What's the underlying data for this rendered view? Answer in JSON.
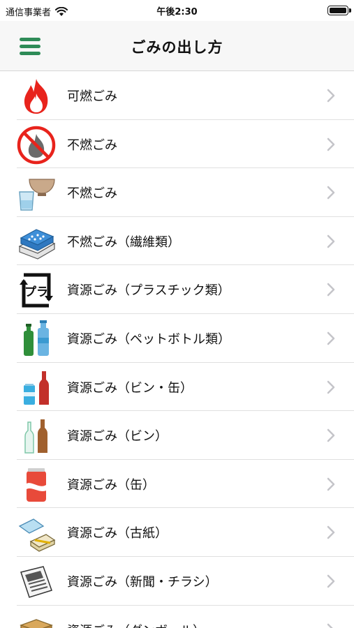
{
  "status_bar": {
    "carrier": "通信事業者",
    "time": "午後2:30"
  },
  "nav": {
    "title": "ごみの出し方"
  },
  "items": [
    {
      "label": "可燃ごみ",
      "icon": "burnable-fire-icon"
    },
    {
      "label": "不燃ごみ",
      "icon": "no-fire-icon"
    },
    {
      "label": "不燃ごみ",
      "icon": "bowl-glass-icon"
    },
    {
      "label": "不燃ごみ（繊維類）",
      "icon": "fabric-icon"
    },
    {
      "label": "資源ごみ（プラスチック類）",
      "icon": "plastic-recycle-icon"
    },
    {
      "label": "資源ごみ（ペットボトル類）",
      "icon": "pet-bottles-icon"
    },
    {
      "label": "資源ごみ（ビン・缶）",
      "icon": "can-bottle-icon"
    },
    {
      "label": "資源ごみ（ビン）",
      "icon": "glass-bottles-icon"
    },
    {
      "label": "資源ごみ（缶）",
      "icon": "can-icon"
    },
    {
      "label": "資源ごみ（古紙）",
      "icon": "old-paper-icon"
    },
    {
      "label": "資源ごみ（新聞・チラシ）",
      "icon": "newspaper-icon"
    },
    {
      "label": "資源ごみ（ダンボール）",
      "icon": "cardboard-icon"
    }
  ],
  "colors": {
    "accent": "#2e8b57",
    "chevron": "#c4c4c9",
    "fire": "#e8231c"
  }
}
